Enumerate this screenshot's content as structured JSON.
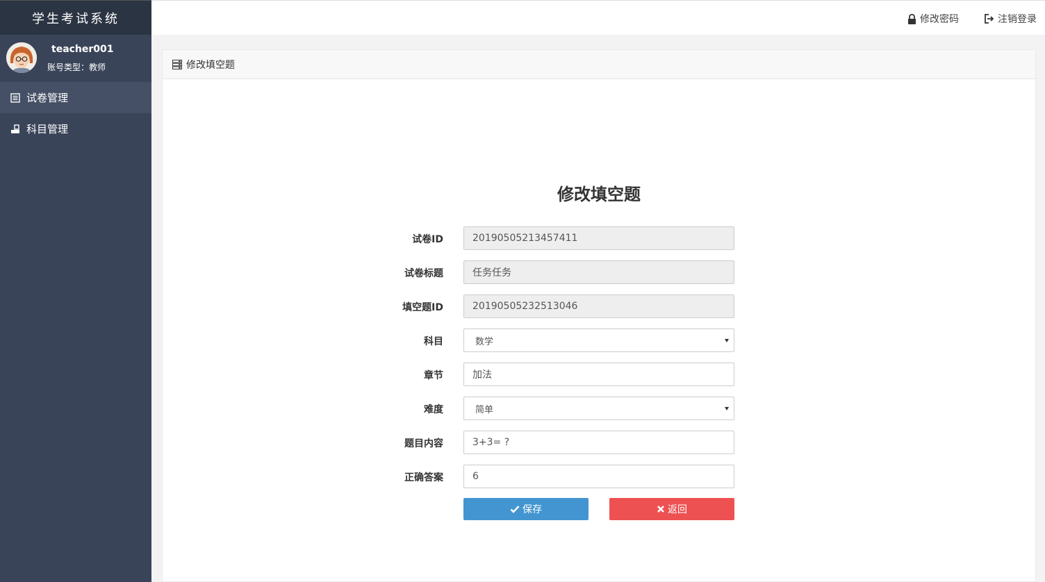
{
  "app": {
    "title": "学生考试系统"
  },
  "user": {
    "name": "teacher001",
    "type_label": "账号类型：教师"
  },
  "sidebar": {
    "items": [
      {
        "label": "试卷管理",
        "icon": "list-icon",
        "active": true
      },
      {
        "label": "科目管理",
        "icon": "subject-icon",
        "active": false
      }
    ]
  },
  "topbar": {
    "change_password": "修改密码",
    "logout": "注销登录"
  },
  "panel": {
    "heading": "修改填空题"
  },
  "form": {
    "title": "修改填空题",
    "fields": {
      "paper_id": {
        "label": "试卷ID",
        "value": "20190505213457411"
      },
      "paper_title": {
        "label": "试卷标题",
        "value": "任务任务"
      },
      "blank_id": {
        "label": "填空题ID",
        "value": "20190505232513046"
      },
      "subject": {
        "label": "科目",
        "value": "数学"
      },
      "chapter": {
        "label": "章节",
        "value": "加法"
      },
      "difficulty": {
        "label": "难度",
        "value": "简单"
      },
      "content": {
        "label": "题目内容",
        "value": "3+3= ?"
      },
      "answer": {
        "label": "正确答案",
        "value": "6"
      }
    },
    "save_label": "保存",
    "back_label": "返回"
  },
  "colors": {
    "sidebar": "#3a4459",
    "brand": "#2b3443",
    "save": "#4395d1",
    "back": "#ed5152"
  }
}
